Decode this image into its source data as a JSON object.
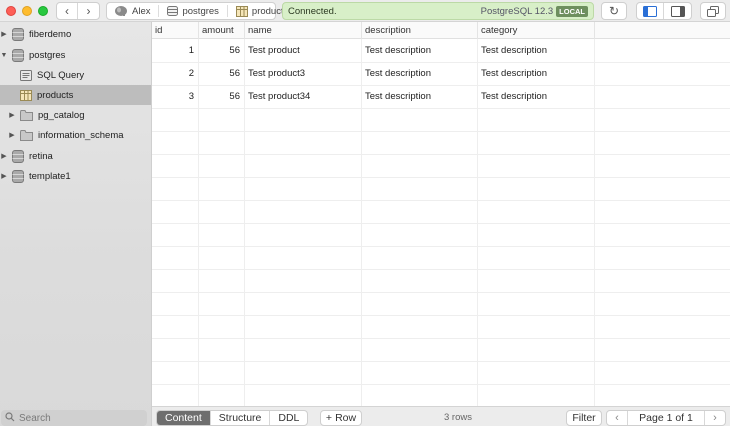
{
  "toolbar": {
    "breadcrumbs": [
      {
        "label": "Alex",
        "icon": "elephant-icon"
      },
      {
        "label": "postgres",
        "icon": "database-icon"
      },
      {
        "label": "products",
        "icon": "table-icon"
      }
    ],
    "status": "Connected.",
    "server_version": "PostgreSQL 12.3",
    "server_badge": "LOCAL",
    "status_color": "#d8efc8"
  },
  "sidebar": {
    "items": [
      {
        "label": "fiberdemo",
        "icon": "database-icon",
        "expanded": false
      },
      {
        "label": "postgres",
        "icon": "database-icon",
        "expanded": true
      },
      {
        "label": "SQL Query",
        "icon": "sql-query-icon"
      },
      {
        "label": "products",
        "icon": "table-icon",
        "selected": true
      },
      {
        "label": "pg_catalog",
        "icon": "folder-icon",
        "expanded": false
      },
      {
        "label": "information_schema",
        "icon": "folder-icon",
        "expanded": false
      },
      {
        "label": "retina",
        "icon": "database-icon",
        "expanded": false
      },
      {
        "label": "template1",
        "icon": "database-icon",
        "expanded": false
      }
    ],
    "search_placeholder": "Search"
  },
  "table": {
    "columns": [
      "id",
      "amount",
      "name",
      "description",
      "category"
    ],
    "rows": [
      [
        "1",
        "56",
        "Test product",
        "Test description",
        "Test description"
      ],
      [
        "2",
        "56",
        "Test product3",
        "Test description",
        "Test description"
      ],
      [
        "3",
        "56",
        "Test product34",
        "Test description",
        "Test description"
      ]
    ]
  },
  "bottombar": {
    "tabs": [
      "Content",
      "Structure",
      "DDL"
    ],
    "active_tab": "Content",
    "add_row_label": "Row",
    "row_count": "3 rows",
    "filter_label": "Filter",
    "page_label": "Page 1 of 1"
  }
}
